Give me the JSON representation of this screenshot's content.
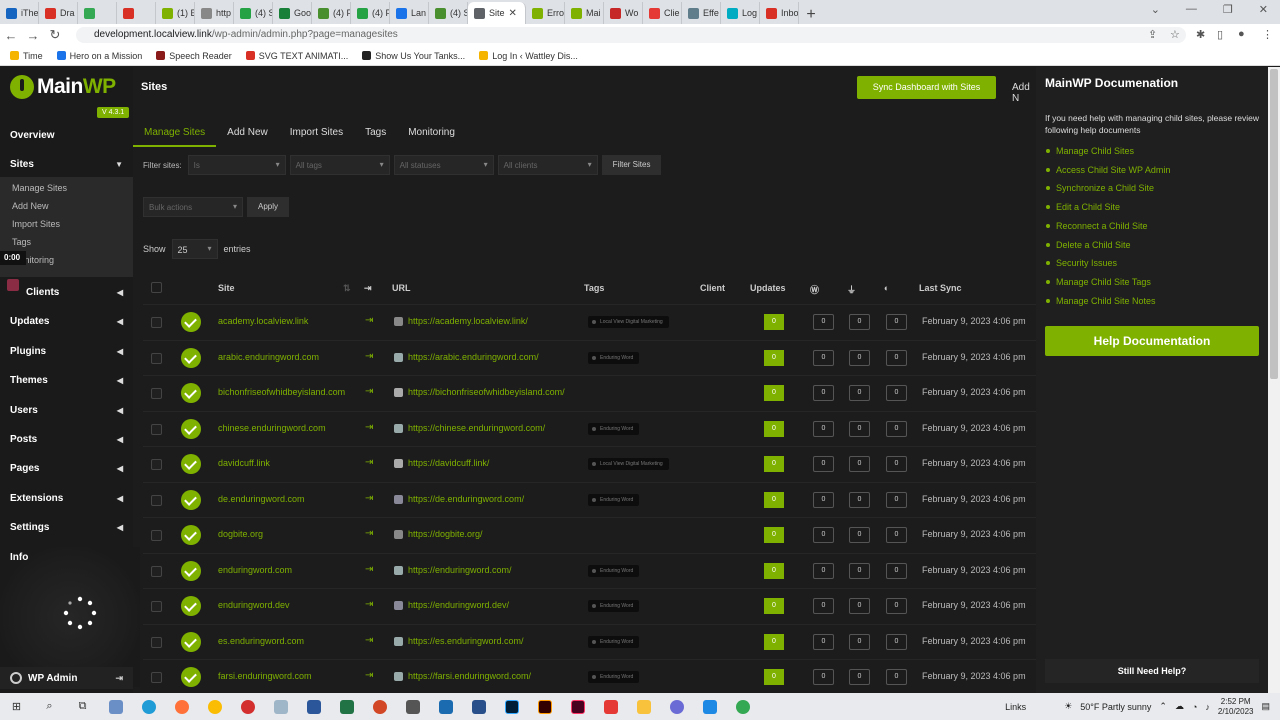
{
  "browser": {
    "tabs": [
      {
        "label": "iThe",
        "color": "#1565c0"
      },
      {
        "label": "Dra",
        "color": "#d93025"
      },
      {
        "label": "",
        "color": "#34a853"
      },
      {
        "label": "",
        "color": "#d93025"
      },
      {
        "label": "(1) E",
        "color": "#7fb100"
      },
      {
        "label": "http",
        "color": "#888888"
      },
      {
        "label": "(4) S",
        "color": "#25a244"
      },
      {
        "label": "Goo",
        "color": "#188038"
      },
      {
        "label": "(4) F",
        "color": "#4a8f2f"
      },
      {
        "label": "(4) F",
        "color": "#25a244"
      },
      {
        "label": "Lan",
        "color": "#1a73e8"
      },
      {
        "label": "(4) S",
        "color": "#4a8f2f"
      },
      {
        "label": "Site",
        "color": "#5f6368",
        "active": true
      },
      {
        "label": "Erro",
        "color": "#7fb100"
      },
      {
        "label": "Mai",
        "color": "#7fb100"
      },
      {
        "label": "Wo",
        "color": "#c62828"
      },
      {
        "label": "Clie",
        "color": "#e53935"
      },
      {
        "label": "Effe",
        "color": "#607d8b"
      },
      {
        "label": "Log",
        "color": "#00acc1"
      },
      {
        "label": "Inbo",
        "color": "#d93025"
      }
    ],
    "url_host": "development.localview.link",
    "url_path": "/wp-admin/admin.php?page=managesites",
    "bookmarks": [
      {
        "label": "Time",
        "color": "#f4b400"
      },
      {
        "label": "Hero on a Mission",
        "color": "#1a73e8"
      },
      {
        "label": "Speech Reader",
        "color": "#8b1a1a"
      },
      {
        "label": "SVG TEXT ANIMATI...",
        "color": "#d93025"
      },
      {
        "label": "Show Us Your Tanks...",
        "color": "#222222"
      },
      {
        "label": "Log In ‹ Wattley Dis...",
        "color": "#f4b400"
      }
    ]
  },
  "sidebar": {
    "logo_main": "Main",
    "logo_wp": "WP",
    "version": "V 4.3.1",
    "overview": "Overview",
    "sites": "Sites",
    "sub_items": [
      "Manage Sites",
      "Add New",
      "Import Sites",
      "Tags",
      "Monitoring"
    ],
    "timer": "0:00",
    "menu": [
      "Clients",
      "Updates",
      "Plugins",
      "Themes",
      "Users",
      "Posts",
      "Pages",
      "Extensions",
      "Settings",
      "Info"
    ],
    "wp_admin": "WP Admin"
  },
  "header": {
    "title": "Sites",
    "sync_button": "Sync Dashboard with Sites",
    "add_new": "Add N"
  },
  "tabs": [
    "Manage Sites",
    "Add New",
    "Import Sites",
    "Tags",
    "Monitoring"
  ],
  "filters": {
    "label": "Filter sites:",
    "status_placeholder": "Is",
    "tags_placeholder": "All tags",
    "statuses_placeholder": "All statuses",
    "clients_placeholder": "All clients",
    "filter_button": "Filter Sites",
    "bulk_placeholder": "Bulk actions",
    "apply_button": "Apply",
    "show_label": "Show",
    "show_value": "25",
    "entries_label": "entries"
  },
  "table": {
    "columns": {
      "site": "Site",
      "url": "URL",
      "tags": "Tags",
      "client": "Client",
      "updates": "Updates",
      "last_sync": "Last Sync"
    },
    "rows": [
      {
        "site": "academy.localview.link",
        "url": "https://academy.localview.link/",
        "tag": "Local View Digital Marketing",
        "updates": "0",
        "wp": "0",
        "plugins": "0",
        "themes": "0",
        "last_sync": "February 9, 2023 4:06 pm"
      },
      {
        "site": "arabic.enduringword.com",
        "url": "https://arabic.enduringword.com/",
        "tag": "Enduring Word",
        "updates": "0",
        "wp": "0",
        "plugins": "0",
        "themes": "0",
        "last_sync": "February 9, 2023 4:06 pm"
      },
      {
        "site": "bichonfriseofwhidbeyisland.com",
        "url": "https://bichonfriseofwhidbeyisland.com/",
        "tag": "",
        "updates": "0",
        "wp": "0",
        "plugins": "0",
        "themes": "0",
        "last_sync": "February 9, 2023 4:06 pm"
      },
      {
        "site": "chinese.enduringword.com",
        "url": "https://chinese.enduringword.com/",
        "tag": "Enduring Word",
        "updates": "0",
        "wp": "0",
        "plugins": "0",
        "themes": "0",
        "last_sync": "February 9, 2023 4:06 pm"
      },
      {
        "site": "davidcuff.link",
        "url": "https://davidcuff.link/",
        "tag": "Local View Digital Marketing",
        "updates": "0",
        "wp": "0",
        "plugins": "0",
        "themes": "0",
        "last_sync": "February 9, 2023 4:06 pm"
      },
      {
        "site": "de.enduringword.com",
        "url": "https://de.enduringword.com/",
        "tag": "Enduring Word",
        "updates": "0",
        "wp": "0",
        "plugins": "0",
        "themes": "0",
        "last_sync": "February 9, 2023 4:06 pm"
      },
      {
        "site": "dogbite.org",
        "url": "https://dogbite.org/",
        "tag": "",
        "updates": "0",
        "wp": "0",
        "plugins": "0",
        "themes": "0",
        "last_sync": "February 9, 2023 4:06 pm"
      },
      {
        "site": "enduringword.com",
        "url": "https://enduringword.com/",
        "tag": "Enduring Word",
        "updates": "0",
        "wp": "0",
        "plugins": "0",
        "themes": "0",
        "last_sync": "February 9, 2023 4:06 pm"
      },
      {
        "site": "enduringword.dev",
        "url": "https://enduringword.dev/",
        "tag": "Enduring Word",
        "updates": "0",
        "wp": "0",
        "plugins": "0",
        "themes": "0",
        "last_sync": "February 9, 2023 4:06 pm"
      },
      {
        "site": "es.enduringword.com",
        "url": "https://es.enduringword.com/",
        "tag": "Enduring Word",
        "updates": "0",
        "wp": "0",
        "plugins": "0",
        "themes": "0",
        "last_sync": "February 9, 2023 4:06 pm"
      },
      {
        "site": "farsi.enduringword.com",
        "url": "https://farsi.enduringword.com/",
        "tag": "Enduring Word",
        "updates": "0",
        "wp": "0",
        "plugins": "0",
        "themes": "0",
        "last_sync": "February 9, 2023 4:06 pm"
      }
    ]
  },
  "docs": {
    "title": "MainWP Documenation",
    "intro": "If you need help with managing child sites, please review following help documents",
    "links": [
      "Manage Child Sites",
      "Access Child Site WP Admin",
      "Synchronize a Child Site",
      "Edit a Child Site",
      "Reconnect a Child Site",
      "Delete a Child Site",
      "Security Issues",
      "Manage Child Site Tags",
      "Manage Child Site Notes"
    ],
    "help_button": "Help Documentation",
    "still_help": "Still Need Help?"
  },
  "taskbar": {
    "links": "Links",
    "weather": "50°F  Partly sunny",
    "time": "2:52 PM",
    "date": "2/10/2023"
  },
  "colors": {
    "accent": "#7fb100",
    "background": "#1c1c1c",
    "sidebar": "#1a1a1a"
  }
}
